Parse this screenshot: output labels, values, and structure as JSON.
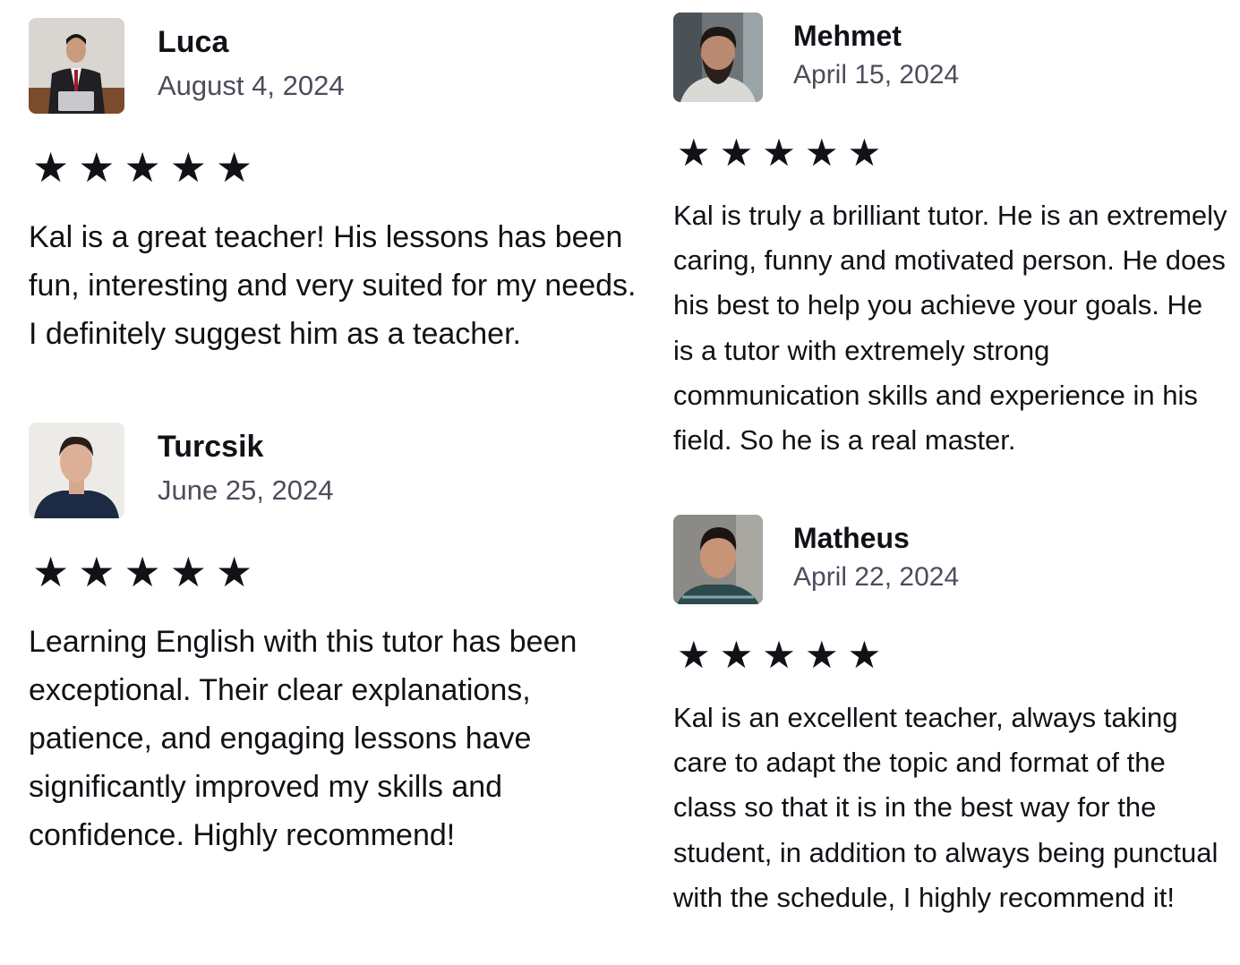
{
  "reviews": [
    {
      "name": "Luca",
      "date": "August 4, 2024",
      "rating": 5,
      "stars": "★★★★★",
      "text": "Kal is a great teacher! His lessons has been fun, interesting and very suited for my needs. I definitely suggest him as a teacher."
    },
    {
      "name": "Turcsik",
      "date": "June 25, 2024",
      "rating": 5,
      "stars": "★★★★★",
      "text": "Learning English with this tutor has been exceptional. Their clear explanations, patience, and engaging lessons have significantly improved my skills and confidence. Highly recommend!"
    },
    {
      "name": "Mehmet",
      "date": "April 15, 2024",
      "rating": 5,
      "stars": "★★★★★",
      "text": "Kal is truly a brilliant tutor. He is an extremely caring, funny and motivated person. He does his best to help you achieve your goals. He is a tutor with extremely strong communication skills and experience in his field. So he is a real master."
    },
    {
      "name": "Matheus",
      "date": "April 22, 2024",
      "rating": 5,
      "stars": "★★★★★",
      "text": "Kal is an excellent teacher, always taking care to adapt the topic and format of the class so that it is in the best way for the student, in addition to always being punctual with the schedule, I highly recommend it!"
    }
  ]
}
